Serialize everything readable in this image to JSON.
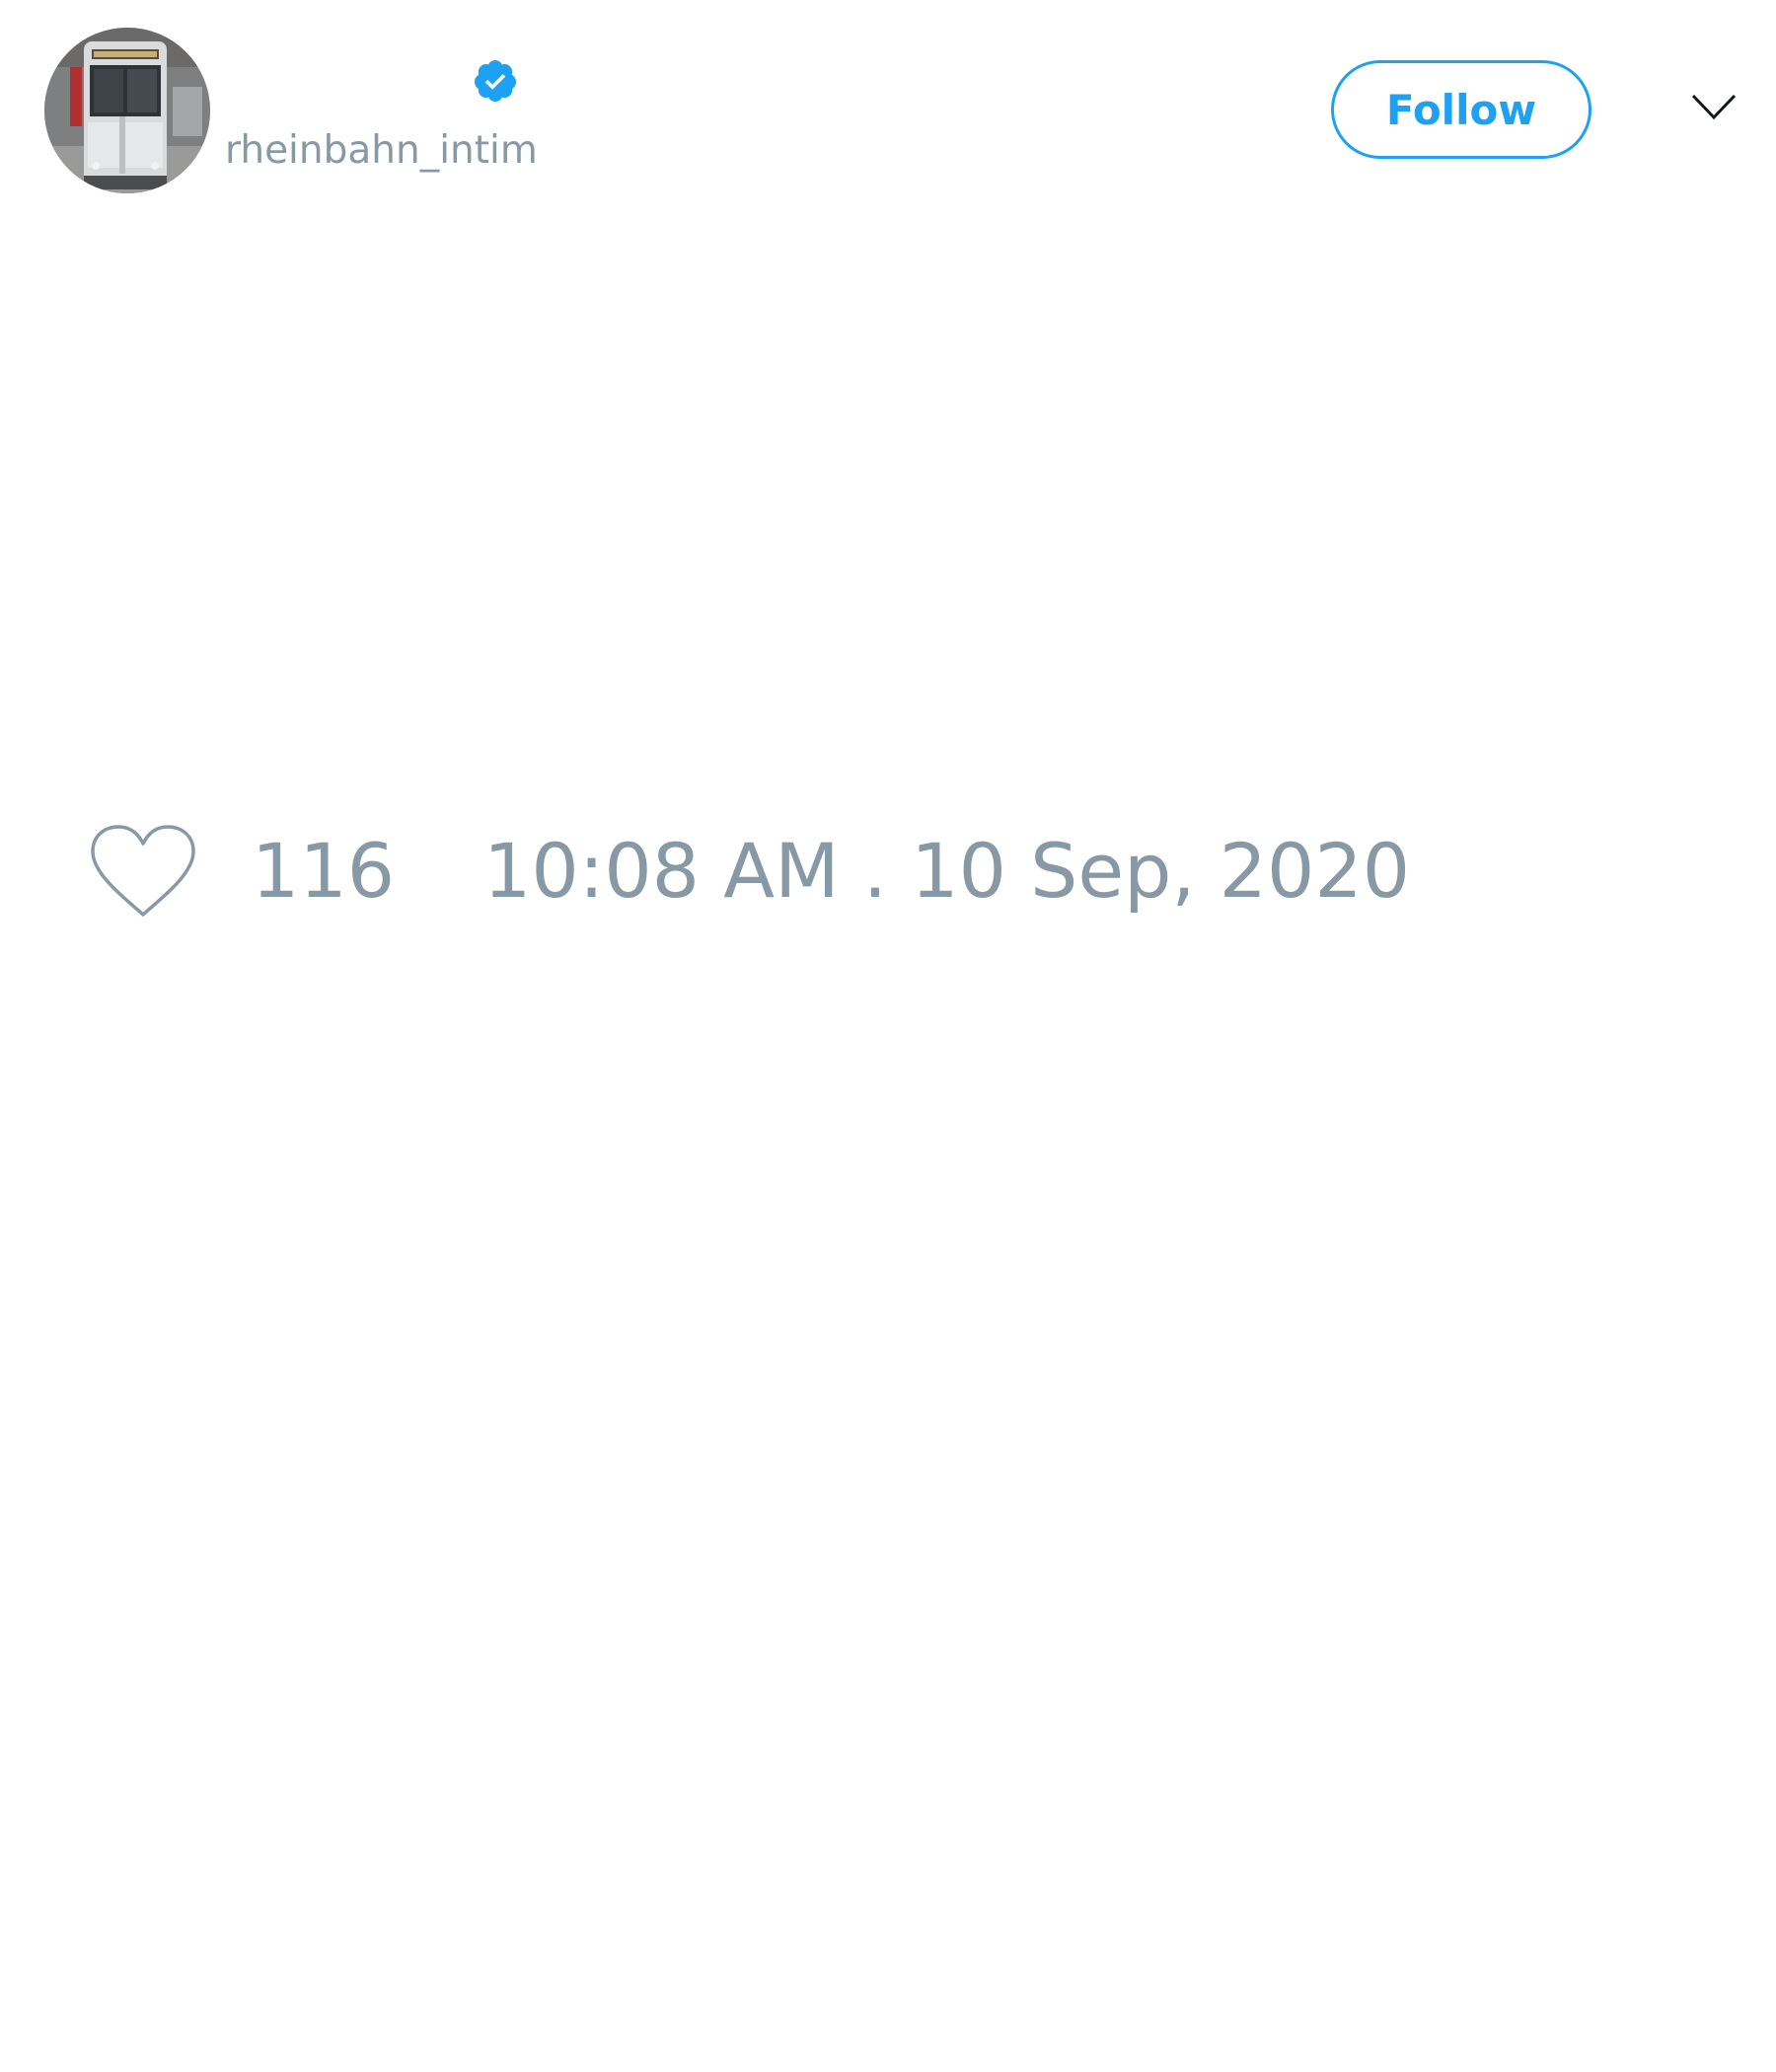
{
  "header": {
    "display_name": "",
    "handle": "rheinbahn_intim",
    "verified": true,
    "follow_label": "Follow"
  },
  "footer": {
    "like_count": "116",
    "timestamp": "10:08 AM . 10 Sep, 2020"
  },
  "icons": {
    "avatar": "avatar-tram-photo",
    "verified": "verified-badge-icon",
    "menu": "chevron-down-icon",
    "like": "heart-outline-icon"
  },
  "colors": {
    "accent": "#1da1f2",
    "muted_text": "#8899a6",
    "background": "#ffffff"
  }
}
